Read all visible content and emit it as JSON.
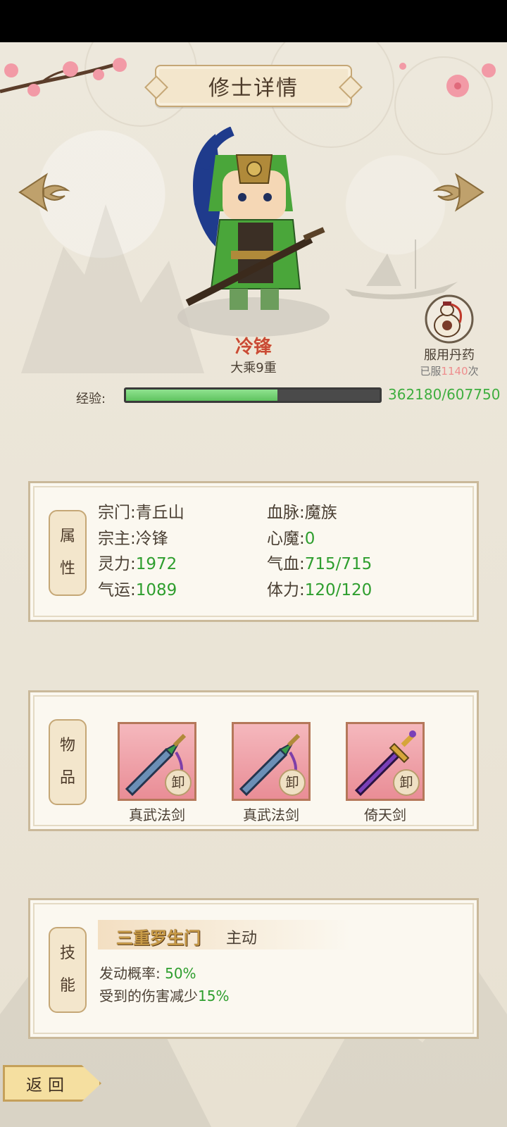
{
  "header": {
    "title": "修士详情"
  },
  "character": {
    "name": "冷锋",
    "rank": "大乘9重"
  },
  "pill": {
    "label": "服用丹药",
    "count_prefix": "已服",
    "count": "1140",
    "count_suffix": "次"
  },
  "experience": {
    "label": "经验:",
    "value_text": "362180/607750",
    "current": 362180,
    "max": 607750
  },
  "attributes": {
    "tag_chars": [
      "属",
      "性"
    ],
    "rows": [
      {
        "key": "宗门",
        "value": "青丘山",
        "green": false
      },
      {
        "key": "血脉",
        "value": "魔族",
        "green": false
      },
      {
        "key": "宗主",
        "value": "冷锋",
        "green": false
      },
      {
        "key": "心魔",
        "value": "0",
        "green": true
      },
      {
        "key": "灵力",
        "value": "1972",
        "green": true
      },
      {
        "key": "气血",
        "value": "715/715",
        "green": true
      },
      {
        "key": "气运",
        "value": "1089",
        "green": true
      },
      {
        "key": "体力",
        "value": "120/120",
        "green": true
      }
    ]
  },
  "items": {
    "tag_chars": [
      "物",
      "品"
    ],
    "unequip_label": "卸",
    "list": [
      {
        "name": "真武法剑",
        "icon": "blue-sword-icon"
      },
      {
        "name": "真武法剑",
        "icon": "blue-sword-icon"
      },
      {
        "name": "倚天剑",
        "icon": "purple-sword-icon"
      }
    ]
  },
  "skill": {
    "tag_chars": [
      "技",
      "能"
    ],
    "name": "三重罗生门",
    "type": "主动",
    "chance_label": "发动概率:",
    "chance_value": "50%",
    "effect_prefix": "受到的伤害减少",
    "effect_value": "15%"
  },
  "footer": {
    "back_label": "返回"
  },
  "colors": {
    "green_text": "#2e9e2e",
    "name_red": "#c94a36",
    "exp_green": "#5fc45f"
  }
}
